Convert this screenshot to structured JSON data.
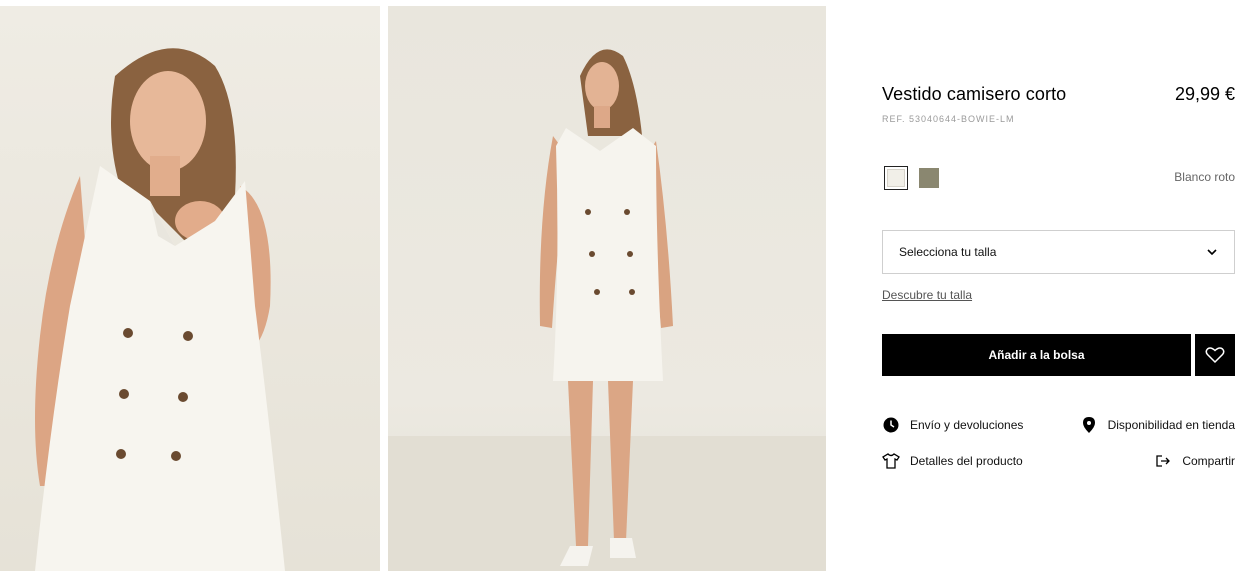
{
  "gallery": {
    "images": [
      {
        "name": "product-photo-closeup"
      },
      {
        "name": "product-photo-fullbody"
      }
    ]
  },
  "product": {
    "title": "Vestido camisero corto",
    "price": "29,99 €",
    "ref": "REF. 53040644-BOWIE-LM"
  },
  "colors": {
    "selected_name": "Blanco roto",
    "options": [
      {
        "hex": "#f1efe8"
      },
      {
        "hex": "#8a8770"
      }
    ]
  },
  "size": {
    "placeholder": "Selecciona tu talla",
    "guide_link": "Descubre tu talla"
  },
  "actions": {
    "add_to_bag": "Añadir a la bolsa",
    "favorite_icon": "heart-icon"
  },
  "info": {
    "shipping": "Envío y devoluciones",
    "store_availability": "Disponibilidad en tienda",
    "details": "Detalles del producto",
    "share": "Compartir"
  }
}
